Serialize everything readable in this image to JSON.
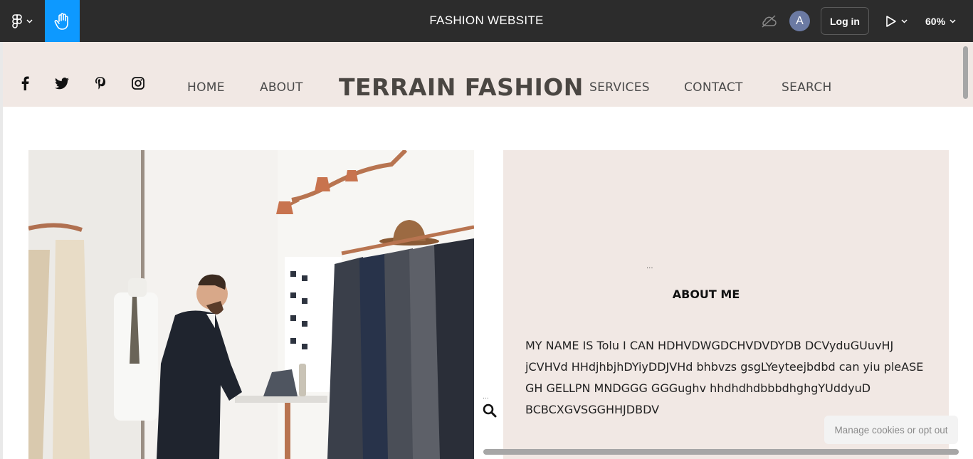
{
  "toolbar": {
    "file_title": "FASHION WEBSITE",
    "avatar_initial": "A",
    "login_label": "Log in",
    "zoom_label": "60%",
    "accent_color": "#0d99ff"
  },
  "site": {
    "nav_left": [
      "HOME",
      "ABOUT"
    ],
    "brand": "TERRAIN FASHION",
    "nav_right": [
      "SERVICES",
      "CONTACT",
      "SEARCH"
    ],
    "social_icons": [
      "facebook-icon",
      "twitter-icon",
      "pinterest-icon",
      "instagram-icon"
    ],
    "header_bg": "#f1e8e4"
  },
  "about": {
    "dots": "...",
    "title": "ABOUT ME",
    "body": "MY  NAME IS Tolu I CAN HDHVDWGDCHVDVDYDB DCVyduGUuvHJ jCVHVd HHdjhbjhDYiyDDJVHd bhbvzs gsgLYeyteejbdbd can yiu pleASE GH GELLPN MNDGGG GGGughv hhdhdhdbbbdhghgYUddyuD BCBCXGVSGGHHJDBDV"
  },
  "search_widget": {
    "dots": "..."
  },
  "cookie_banner": {
    "label": "Manage cookies or opt out"
  }
}
